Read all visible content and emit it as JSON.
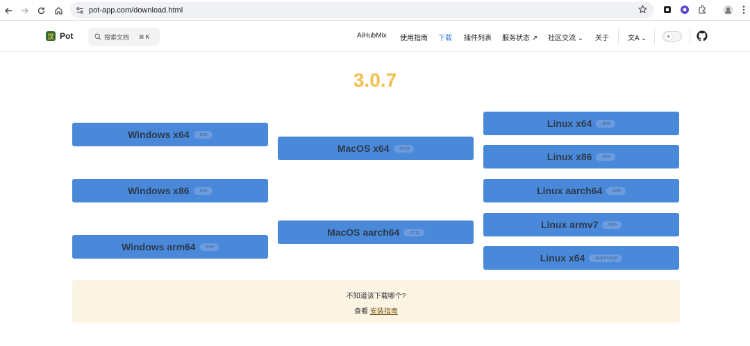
{
  "browser": {
    "url": "pot-app.com/download.html"
  },
  "header": {
    "brand": "Pot",
    "search_label": "搜索文档",
    "search_shortcut": "⌘ K",
    "nav": {
      "aihubmix": "AiHubMix",
      "guide": "使用指南",
      "download": "下载",
      "plugins": "插件列表",
      "status": "服务状态 ↗",
      "community": "社区交流 ⌄",
      "about": "关于",
      "lang": "文A ⌄"
    },
    "accent": "#3e7fd6"
  },
  "main": {
    "version": "3.0.7",
    "downloads": {
      "windows_x64": {
        "name": "Windows x64",
        "ext": ".exe"
      },
      "windows_x86": {
        "name": "Windows x86",
        "ext": ".exe"
      },
      "windows_arm64": {
        "name": "Windows arm64",
        "ext": ".exe"
      },
      "macos_x64": {
        "name": "MacOS x64",
        "ext": ".dmg"
      },
      "macos_aarch64": {
        "name": "MacOS aarch64",
        "ext": ".dmg"
      },
      "linux_x64_deb": {
        "name": "Linux x64",
        "ext": ".deb"
      },
      "linux_x86_deb": {
        "name": "Linux x86",
        "ext": ".deb"
      },
      "linux_aarch64_deb": {
        "name": "Linux aarch64",
        "ext": ".deb"
      },
      "linux_armv7_deb": {
        "name": "Linux armv7",
        "ext": ".deb"
      },
      "linux_x64_appimage": {
        "name": "Linux x64",
        "ext": ".AppImage"
      }
    },
    "help": {
      "question": "不知道该下载哪个?",
      "prefix": "查看 ",
      "link": "安装指南"
    },
    "colors": {
      "version": "#f2c04e",
      "button": "#4a89d9",
      "help_bg": "#fbf4e2"
    }
  }
}
